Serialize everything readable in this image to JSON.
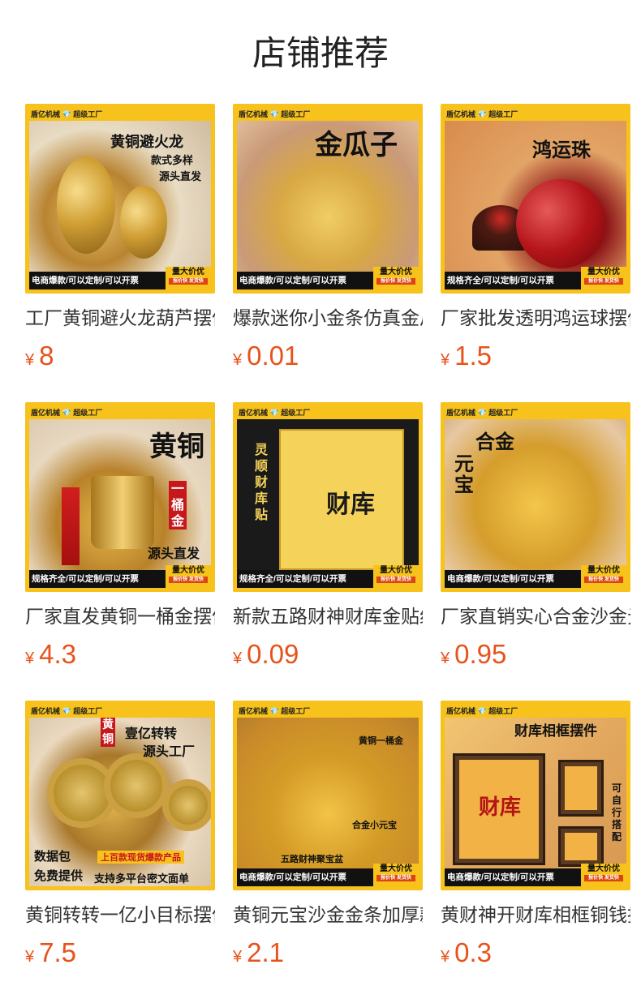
{
  "page": {
    "title": "店铺推荐"
  },
  "products": [
    {
      "title": "工厂黄铜避火龙葫芦摆件",
      "currency": "¥",
      "price": "8",
      "image": {
        "top_bar": "盾亿机械 💎 超级工厂",
        "bottom_bar": "电商爆款/可以定制/可以开票",
        "badge": "量大价优",
        "badge_sub": "报价快 发货快",
        "overlay": [
          "黄铜避火龙",
          "款式多样",
          "源头直发"
        ]
      }
    },
    {
      "title": "爆款迷你小金条仿真金瓜子",
      "currency": "¥",
      "price": "0.01",
      "image": {
        "top_bar": "盾亿机械 💎 超级工厂",
        "bottom_bar": "电商爆款/可以定制/可以开票",
        "badge": "量大价优",
        "badge_sub": "报价快 发货快",
        "overlay": [
          "金瓜子"
        ]
      }
    },
    {
      "title": "厂家批发透明鸿运球摆件",
      "currency": "¥",
      "price": "1.5",
      "image": {
        "top_bar": "盾亿机械 💎 超级工厂",
        "bottom_bar": "规格齐全/可以定制/可以开票",
        "badge": "量大价优",
        "badge_sub": "报价快 发货快",
        "overlay": [
          "鸿运珠"
        ]
      }
    },
    {
      "title": "厂家直发黄铜一桶金摆件",
      "currency": "¥",
      "price": "4.3",
      "image": {
        "top_bar": "盾亿机械 💎 超级工厂",
        "bottom_bar": "规格齐全/可以定制/可以开票",
        "badge": "量大价优",
        "badge_sub": "报价快 发货快",
        "overlay": [
          "黄铜",
          "一桶金",
          "源头直发"
        ]
      }
    },
    {
      "title": "新款五路财神财库金贴纸",
      "currency": "¥",
      "price": "0.09",
      "image": {
        "top_bar": "盾亿机械 💎 超级工厂",
        "bottom_bar": "规格齐全/可以定制/可以开票",
        "badge": "量大价优",
        "badge_sub": "报价快 发货快",
        "overlay": [
          "灵顺财库贴",
          "财库"
        ]
      }
    },
    {
      "title": "厂家直销实心合金沙金元宝",
      "currency": "¥",
      "price": "0.95",
      "image": {
        "top_bar": "盾亿机械 💎 超级工厂",
        "bottom_bar": "电商爆款/可以定制/可以开票",
        "badge": "量大价优",
        "badge_sub": "报价快 发货快",
        "overlay": [
          "合金",
          "元宝"
        ]
      }
    },
    {
      "title": "黄铜转转一亿小目标摆件",
      "currency": "¥",
      "price": "7.5",
      "image": {
        "top_bar": "盾亿机械 💎 超级工厂",
        "bottom_bar": "",
        "badge": "",
        "badge_sub": "",
        "overlay": [
          "黄铜",
          "壹亿转转",
          "源头工厂",
          "数据包",
          "免费提供",
          "上百款现货爆款产品",
          "支持多平台密文面单"
        ]
      }
    },
    {
      "title": "黄铜元宝沙金金条加厚款",
      "currency": "¥",
      "price": "2.1",
      "image": {
        "top_bar": "盾亿机械 💎 超级工厂",
        "bottom_bar": "电商爆款/可以定制/可以开票",
        "badge": "量大价优",
        "badge_sub": "报价快 发货快",
        "overlay": [
          "黄铜一桶金",
          "合金小元宝",
          "五路财神聚宝盆"
        ]
      }
    },
    {
      "title": "黄财神开财库相框铜钱摆件",
      "currency": "¥",
      "price": "0.3",
      "image": {
        "top_bar": "盾亿机械 💎 超级工厂",
        "bottom_bar": "电商爆款/可以定制/可以开票",
        "badge": "量大价优",
        "badge_sub": "报价快 发货快",
        "overlay": [
          "财库相框摆件",
          "财库",
          "可自行搭配"
        ]
      }
    }
  ]
}
